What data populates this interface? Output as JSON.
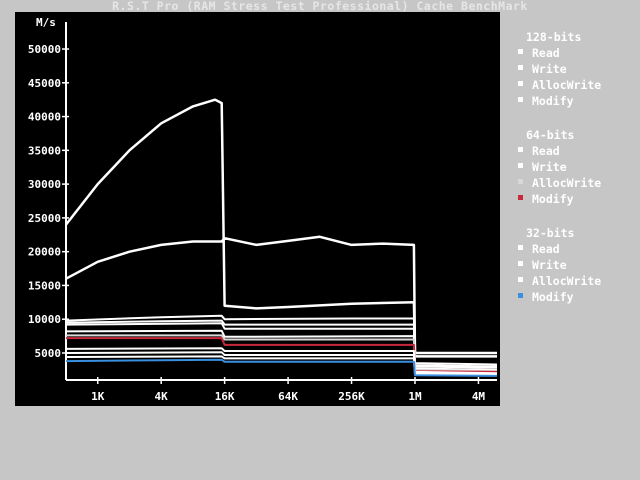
{
  "window": {
    "title": "R.S.T Pro (RAM Stress Test Professional)  Cache BenchMark"
  },
  "colors": {
    "background": "#c6c6c6",
    "plot_background": "#000000",
    "axis": "#ffffff"
  },
  "chart_data": {
    "type": "line",
    "title": "",
    "ylabel": "M/s",
    "xlabel": "",
    "x_scale": "log2",
    "x_ticks": [
      {
        "value": 1,
        "label": "1K"
      },
      {
        "value": 4,
        "label": "4K"
      },
      {
        "value": 16,
        "label": "16K"
      },
      {
        "value": 64,
        "label": "64K"
      },
      {
        "value": 256,
        "label": "256K"
      },
      {
        "value": 1024,
        "label": "1M"
      },
      {
        "value": 4096,
        "label": "4M"
      }
    ],
    "y_ticks": [
      5000,
      10000,
      15000,
      20000,
      25000,
      30000,
      35000,
      40000,
      45000,
      50000
    ],
    "ylim": [
      1000,
      54000
    ],
    "xlim_kb": [
      0.5,
      6144
    ],
    "grid": false,
    "legend_position": "right",
    "groups": [
      {
        "heading": "128-bits",
        "series": [
          {
            "name": "Read",
            "color": "#ffffff",
            "data": [
              [
                0.5,
                24000
              ],
              [
                1,
                30000
              ],
              [
                2,
                35000
              ],
              [
                4,
                39000
              ],
              [
                8,
                41500
              ],
              [
                13,
                42500
              ],
              [
                15,
                42000
              ],
              [
                16,
                12000
              ],
              [
                32,
                11600
              ],
              [
                64,
                11800
              ],
              [
                256,
                12300
              ],
              [
                1000,
                12500
              ],
              [
                1024,
                5000
              ],
              [
                6144,
                5000
              ]
            ]
          },
          {
            "name": "Write",
            "color": "#ffffff",
            "data": [
              [
                0.5,
                16000
              ],
              [
                1,
                18500
              ],
              [
                2,
                20000
              ],
              [
                4,
                21000
              ],
              [
                8,
                21500
              ],
              [
                15,
                21500
              ],
              [
                16,
                22000
              ],
              [
                32,
                21000
              ],
              [
                64,
                21600
              ],
              [
                128,
                22200
              ],
              [
                256,
                21000
              ],
              [
                512,
                21200
              ],
              [
                1000,
                21000
              ],
              [
                1024,
                4500
              ],
              [
                6144,
                4500
              ]
            ]
          },
          {
            "name": "AllocWrite",
            "color": "#ffffff",
            "data": [
              [
                0.5,
                9800
              ],
              [
                4,
                10300
              ],
              [
                15,
                10500
              ],
              [
                16,
                10000
              ],
              [
                256,
                10100
              ],
              [
                1000,
                10100
              ],
              [
                1024,
                3500
              ],
              [
                6144,
                3300
              ]
            ]
          },
          {
            "name": "Modify",
            "color": "#ffffff",
            "data": [
              [
                0.5,
                9500
              ],
              [
                4,
                9700
              ],
              [
                15,
                9800
              ],
              [
                16,
                9200
              ],
              [
                1000,
                9200
              ],
              [
                1024,
                3200
              ],
              [
                6144,
                3000
              ]
            ]
          }
        ]
      },
      {
        "heading": "64-bits",
        "series": [
          {
            "name": "Read",
            "color": "#ffffff",
            "data": [
              [
                0.5,
                9200
              ],
              [
                15,
                9400
              ],
              [
                16,
                8600
              ],
              [
                1000,
                8600
              ],
              [
                1024,
                3000
              ],
              [
                6144,
                2800
              ]
            ]
          },
          {
            "name": "Write",
            "color": "#ffffff",
            "data": [
              [
                0.5,
                8200
              ],
              [
                15,
                8300
              ],
              [
                16,
                7400
              ],
              [
                1000,
                7500
              ],
              [
                1024,
                2700
              ],
              [
                6144,
                2500
              ]
            ]
          },
          {
            "name": "AllocWrite",
            "color": "#d8d8d8",
            "data": [
              [
                0.5,
                7600
              ],
              [
                15,
                7600
              ],
              [
                16,
                7000
              ],
              [
                1000,
                7000
              ],
              [
                1024,
                2500
              ],
              [
                6144,
                2300
              ]
            ]
          },
          {
            "name": "Modify",
            "color": "#c8283c",
            "data": [
              [
                0.5,
                7200
              ],
              [
                15,
                7200
              ],
              [
                16,
                6200
              ],
              [
                1000,
                6200
              ],
              [
                1024,
                2300
              ],
              [
                6144,
                2200
              ]
            ]
          }
        ]
      },
      {
        "heading": "32-bits",
        "series": [
          {
            "name": "Read",
            "color": "#ffffff",
            "data": [
              [
                0.5,
                5600
              ],
              [
                15,
                5700
              ],
              [
                16,
                5300
              ],
              [
                1000,
                5300
              ],
              [
                1024,
                2200
              ],
              [
                6144,
                2000
              ]
            ]
          },
          {
            "name": "Write",
            "color": "#ffffff",
            "data": [
              [
                0.5,
                5000
              ],
              [
                15,
                5100
              ],
              [
                16,
                4700
              ],
              [
                1000,
                4700
              ],
              [
                1024,
                2000
              ],
              [
                6144,
                1800
              ]
            ]
          },
          {
            "name": "AllocWrite",
            "color": "#ffffff",
            "data": [
              [
                0.5,
                4400
              ],
              [
                15,
                4500
              ],
              [
                16,
                4200
              ],
              [
                1000,
                4200
              ],
              [
                1024,
                1800
              ],
              [
                6144,
                1700
              ]
            ]
          },
          {
            "name": "Modify",
            "color": "#3a8fe0",
            "data": [
              [
                0.5,
                3800
              ],
              [
                15,
                4000
              ],
              [
                16,
                3700
              ],
              [
                1000,
                3700
              ],
              [
                1024,
                1700
              ],
              [
                6144,
                1600
              ]
            ]
          }
        ]
      }
    ]
  }
}
